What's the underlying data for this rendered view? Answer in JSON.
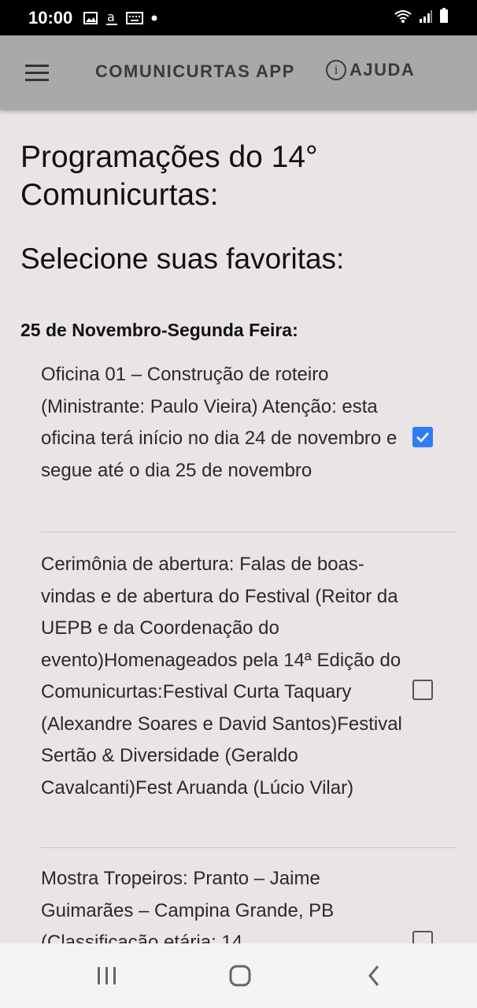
{
  "status_bar": {
    "time": "10:00",
    "icons": [
      "image-icon",
      "a-icon",
      "keyboard-icon",
      "dot-icon",
      "wifi-icon",
      "signal-icon",
      "battery-icon"
    ]
  },
  "app_bar": {
    "title": "COMUNICURTAS APP",
    "help_label": "AJUDA",
    "help_icon_glyph": "i"
  },
  "content": {
    "heading": "Programações do 14° Comunicurtas:",
    "subheading": "Selecione suas favoritas:",
    "day_title": "25 de Novembro-Segunda Feira:",
    "events": [
      {
        "text": "Oficina 01 – Construção de roteiro (Ministrante: Paulo Vieira) Atenção: esta oficina terá início no dia 24 de novembro e segue até o dia 25 de novembro",
        "checked": true
      },
      {
        "text": "Cerimônia de abertura: Falas de boas-vindas e de abertura do Festival (Reitor da UEPB e da Coordenação do evento)Homenageados pela 14ª Edição do Comunicurtas:Festival Curta Taquary (Alexandre Soares e David Santos)Festival Sertão & Diversidade (Geraldo Cavalcanti)Fest Aruanda (Lúcio Vilar)",
        "checked": false
      },
      {
        "text": "Mostra Tropeiros: Pranto – Jaime Guimarães – Campina Grande, PB (Classificação etária: 14",
        "checked": false
      }
    ]
  },
  "colors": {
    "checkbox_checked": "#2f7df6",
    "app_bar": "#a9a9a9",
    "background": "#e9e5e4"
  },
  "nav_bar": {
    "buttons": [
      "recent-apps-icon",
      "home-icon",
      "back-icon"
    ]
  }
}
